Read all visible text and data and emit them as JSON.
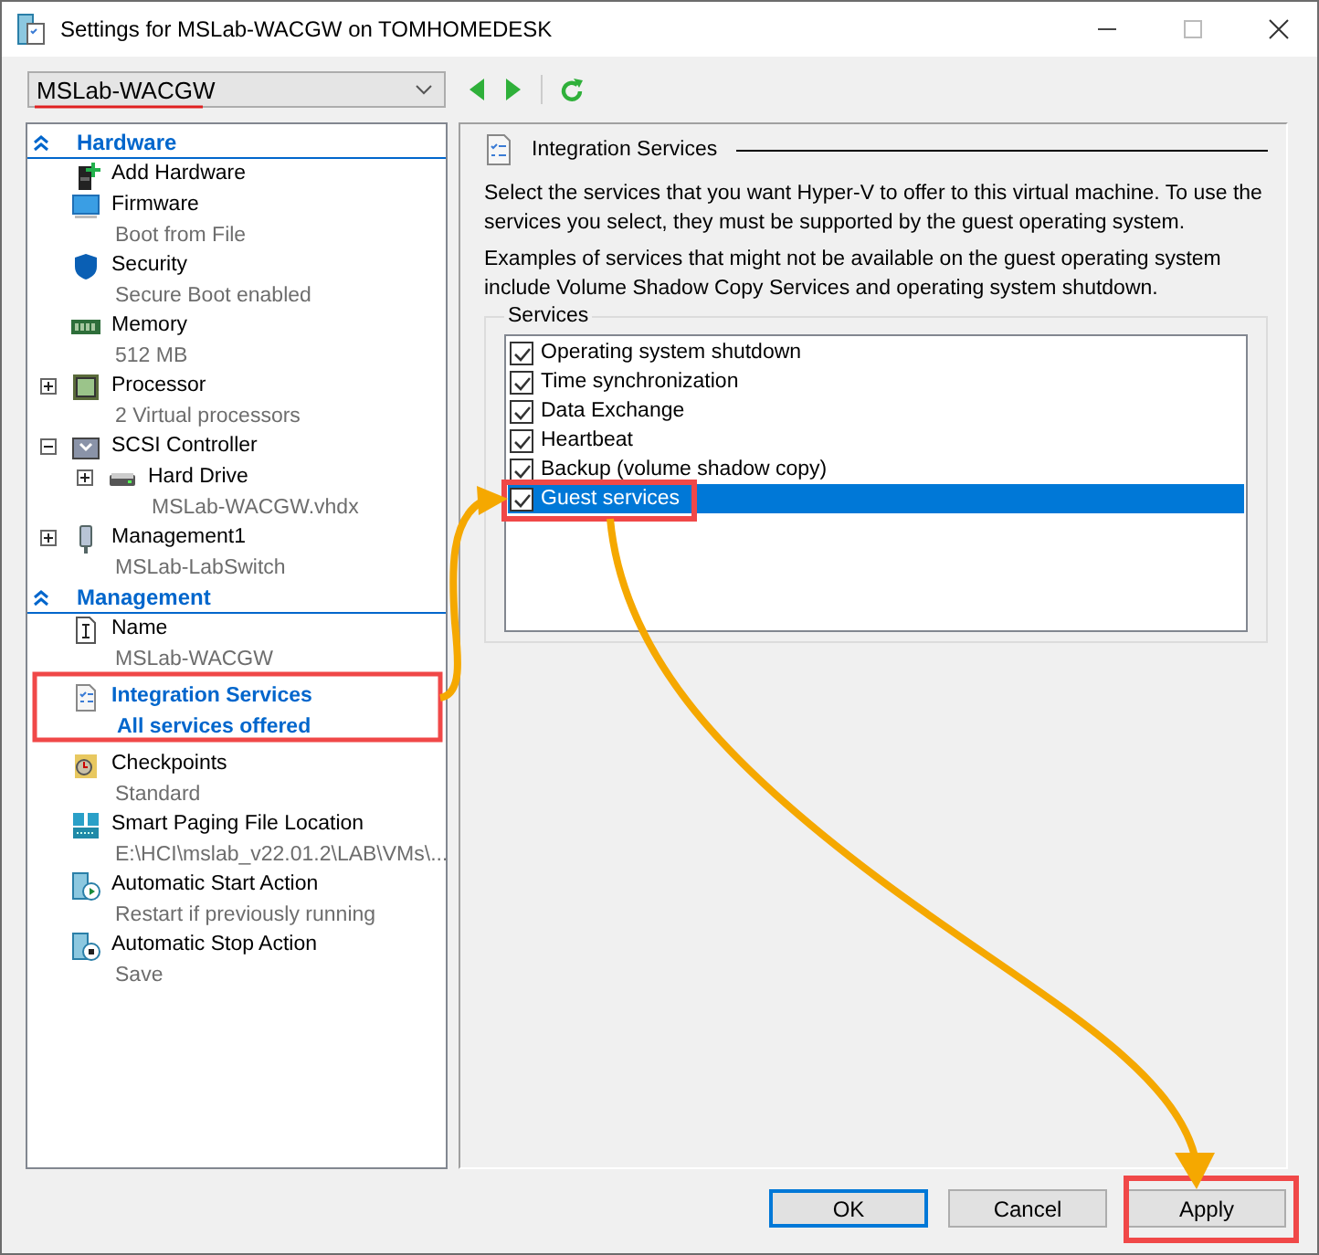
{
  "window": {
    "title": "Settings for MSLab-WACGW on TOMHOMEDESK"
  },
  "vm_selector": {
    "value": "MSLab-WACGW"
  },
  "tree": {
    "sections": [
      {
        "title": "Hardware",
        "expanded": true,
        "items": [
          {
            "label": "Add Hardware",
            "selected": false
          },
          {
            "label": "Firmware",
            "detail": "Boot from File",
            "selected": false
          },
          {
            "label": "Security",
            "detail": "Secure Boot enabled",
            "selected": false
          },
          {
            "label": "Memory",
            "detail": "512 MB",
            "selected": false
          },
          {
            "label": "Processor",
            "detail": "2 Virtual processors",
            "selected": false,
            "expanded": false
          },
          {
            "label": "SCSI Controller",
            "selected": false,
            "expanded": true,
            "children": [
              {
                "label": "Hard Drive",
                "detail": "MSLab-WACGW.vhdx",
                "selected": false,
                "expanded": false
              }
            ]
          },
          {
            "label": "Management1",
            "detail": "MSLab-LabSwitch",
            "selected": false,
            "expanded": false
          }
        ]
      },
      {
        "title": "Management",
        "expanded": true,
        "items": [
          {
            "label": "Name",
            "detail": "MSLab-WACGW",
            "selected": false
          },
          {
            "label": "Integration Services",
            "detail": "All services offered",
            "selected": true
          },
          {
            "label": "Checkpoints",
            "detail": "Standard",
            "selected": false
          },
          {
            "label": "Smart Paging File Location",
            "detail": "E:\\HCI\\mslab_v22.01.2\\LAB\\VMs\\...",
            "selected": false
          },
          {
            "label": "Automatic Start Action",
            "detail": "Restart if previously running",
            "selected": false
          },
          {
            "label": "Automatic Stop Action",
            "detail": "Save",
            "selected": false
          }
        ]
      }
    ]
  },
  "details": {
    "title": "Integration Services",
    "paragraphs": [
      "Select the services that you want Hyper-V to offer to this virtual machine. To use the services you select, they must be supported by the guest operating system.",
      "Examples of services that might not be available on the guest operating system include Volume Shadow Copy Services and operating system shutdown."
    ],
    "services": {
      "legend": "Services",
      "items": [
        {
          "label": "Operating system shutdown",
          "checked": true,
          "selected": false
        },
        {
          "label": "Time synchronization",
          "checked": true,
          "selected": false
        },
        {
          "label": "Data Exchange",
          "checked": true,
          "selected": false
        },
        {
          "label": "Heartbeat",
          "checked": true,
          "selected": false
        },
        {
          "label": "Backup (volume shadow copy)",
          "checked": true,
          "selected": false
        },
        {
          "label": "Guest services",
          "checked": true,
          "selected": true
        }
      ]
    }
  },
  "buttons": [
    {
      "label": "OK",
      "default": true
    },
    {
      "label": "Cancel",
      "default": false
    },
    {
      "label": "Apply",
      "default": false
    }
  ]
}
